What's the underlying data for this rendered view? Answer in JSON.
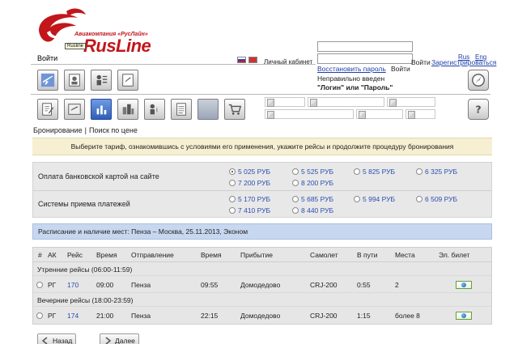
{
  "header": {
    "airline_label": "Авиакомпания «РусЛайн»",
    "brand": "RusLine",
    "tooltip": "Rusline",
    "login_link": "Войти",
    "cabinet_label": "Личный кабинет",
    "restore_link": "Восстановить пароль",
    "enter_label": "Войти",
    "error_line1": "Неправильно введен",
    "error_line2": "\"Логин\" или \"Пароль\"",
    "enter_label_right": "Войти",
    "register_link": "Зарегистрироваться",
    "lang_ru": "Rus",
    "lang_en": "Eng"
  },
  "breadcrumb": {
    "item1": "Бронирование",
    "separator": "|",
    "item2": "Поиск по цене"
  },
  "notice": "Выберите тариф, ознакомившись с условиями его применения, укажите рейсы и продолжите процедуру бронирования",
  "payment": {
    "card_label": "Оплата банковской картой на сайте",
    "card_options": [
      "5 025 РУБ",
      "5 525 РУБ",
      "5 825 РУБ",
      "6 325 РУБ",
      "7 200 РУБ",
      "8 200 РУБ"
    ],
    "systems_label": "Системы приема платежей",
    "systems_options": [
      "5 170 РУБ",
      "5 685 РУБ",
      "5 994 РУБ",
      "6 509 РУБ",
      "7 410 РУБ",
      "8 440 РУБ"
    ]
  },
  "schedule_title": "Расписание и наличие мест: Пенза – Москва,  25.11.2013, Эконом",
  "table": {
    "headers": [
      "#",
      "АК",
      "Рейс",
      "Время",
      "Отправление",
      "Время",
      "Прибытие",
      "Самолет",
      "В пути",
      "Места",
      "Эл. билет"
    ],
    "morning_label": "Утренние рейсы (06:00-11:59)",
    "evening_label": "Вечерние рейсы (18:00-23:59)",
    "morning": {
      "ak": "РГ",
      "flight": "170",
      "dep_time": "09:00",
      "from": "Пенза",
      "arr_time": "09:55",
      "to": "Домодедово",
      "plane": "CRJ-200",
      "duration": "0:55",
      "seats": "2"
    },
    "evening": {
      "ak": "РГ",
      "flight": "174",
      "dep_time": "21:00",
      "from": "Пенза",
      "arr_time": "22:15",
      "to": "Домодедово",
      "plane": "CRJ-200",
      "duration": "1:15",
      "seats": "более 8"
    }
  },
  "nav": {
    "back": "Назад",
    "next": "Далее"
  },
  "colors": {
    "brand_red": "#c2161b",
    "link_blue": "#2b4fb0",
    "notice_bg": "#f6efd2",
    "schedule_bg": "#c7d7ef"
  }
}
